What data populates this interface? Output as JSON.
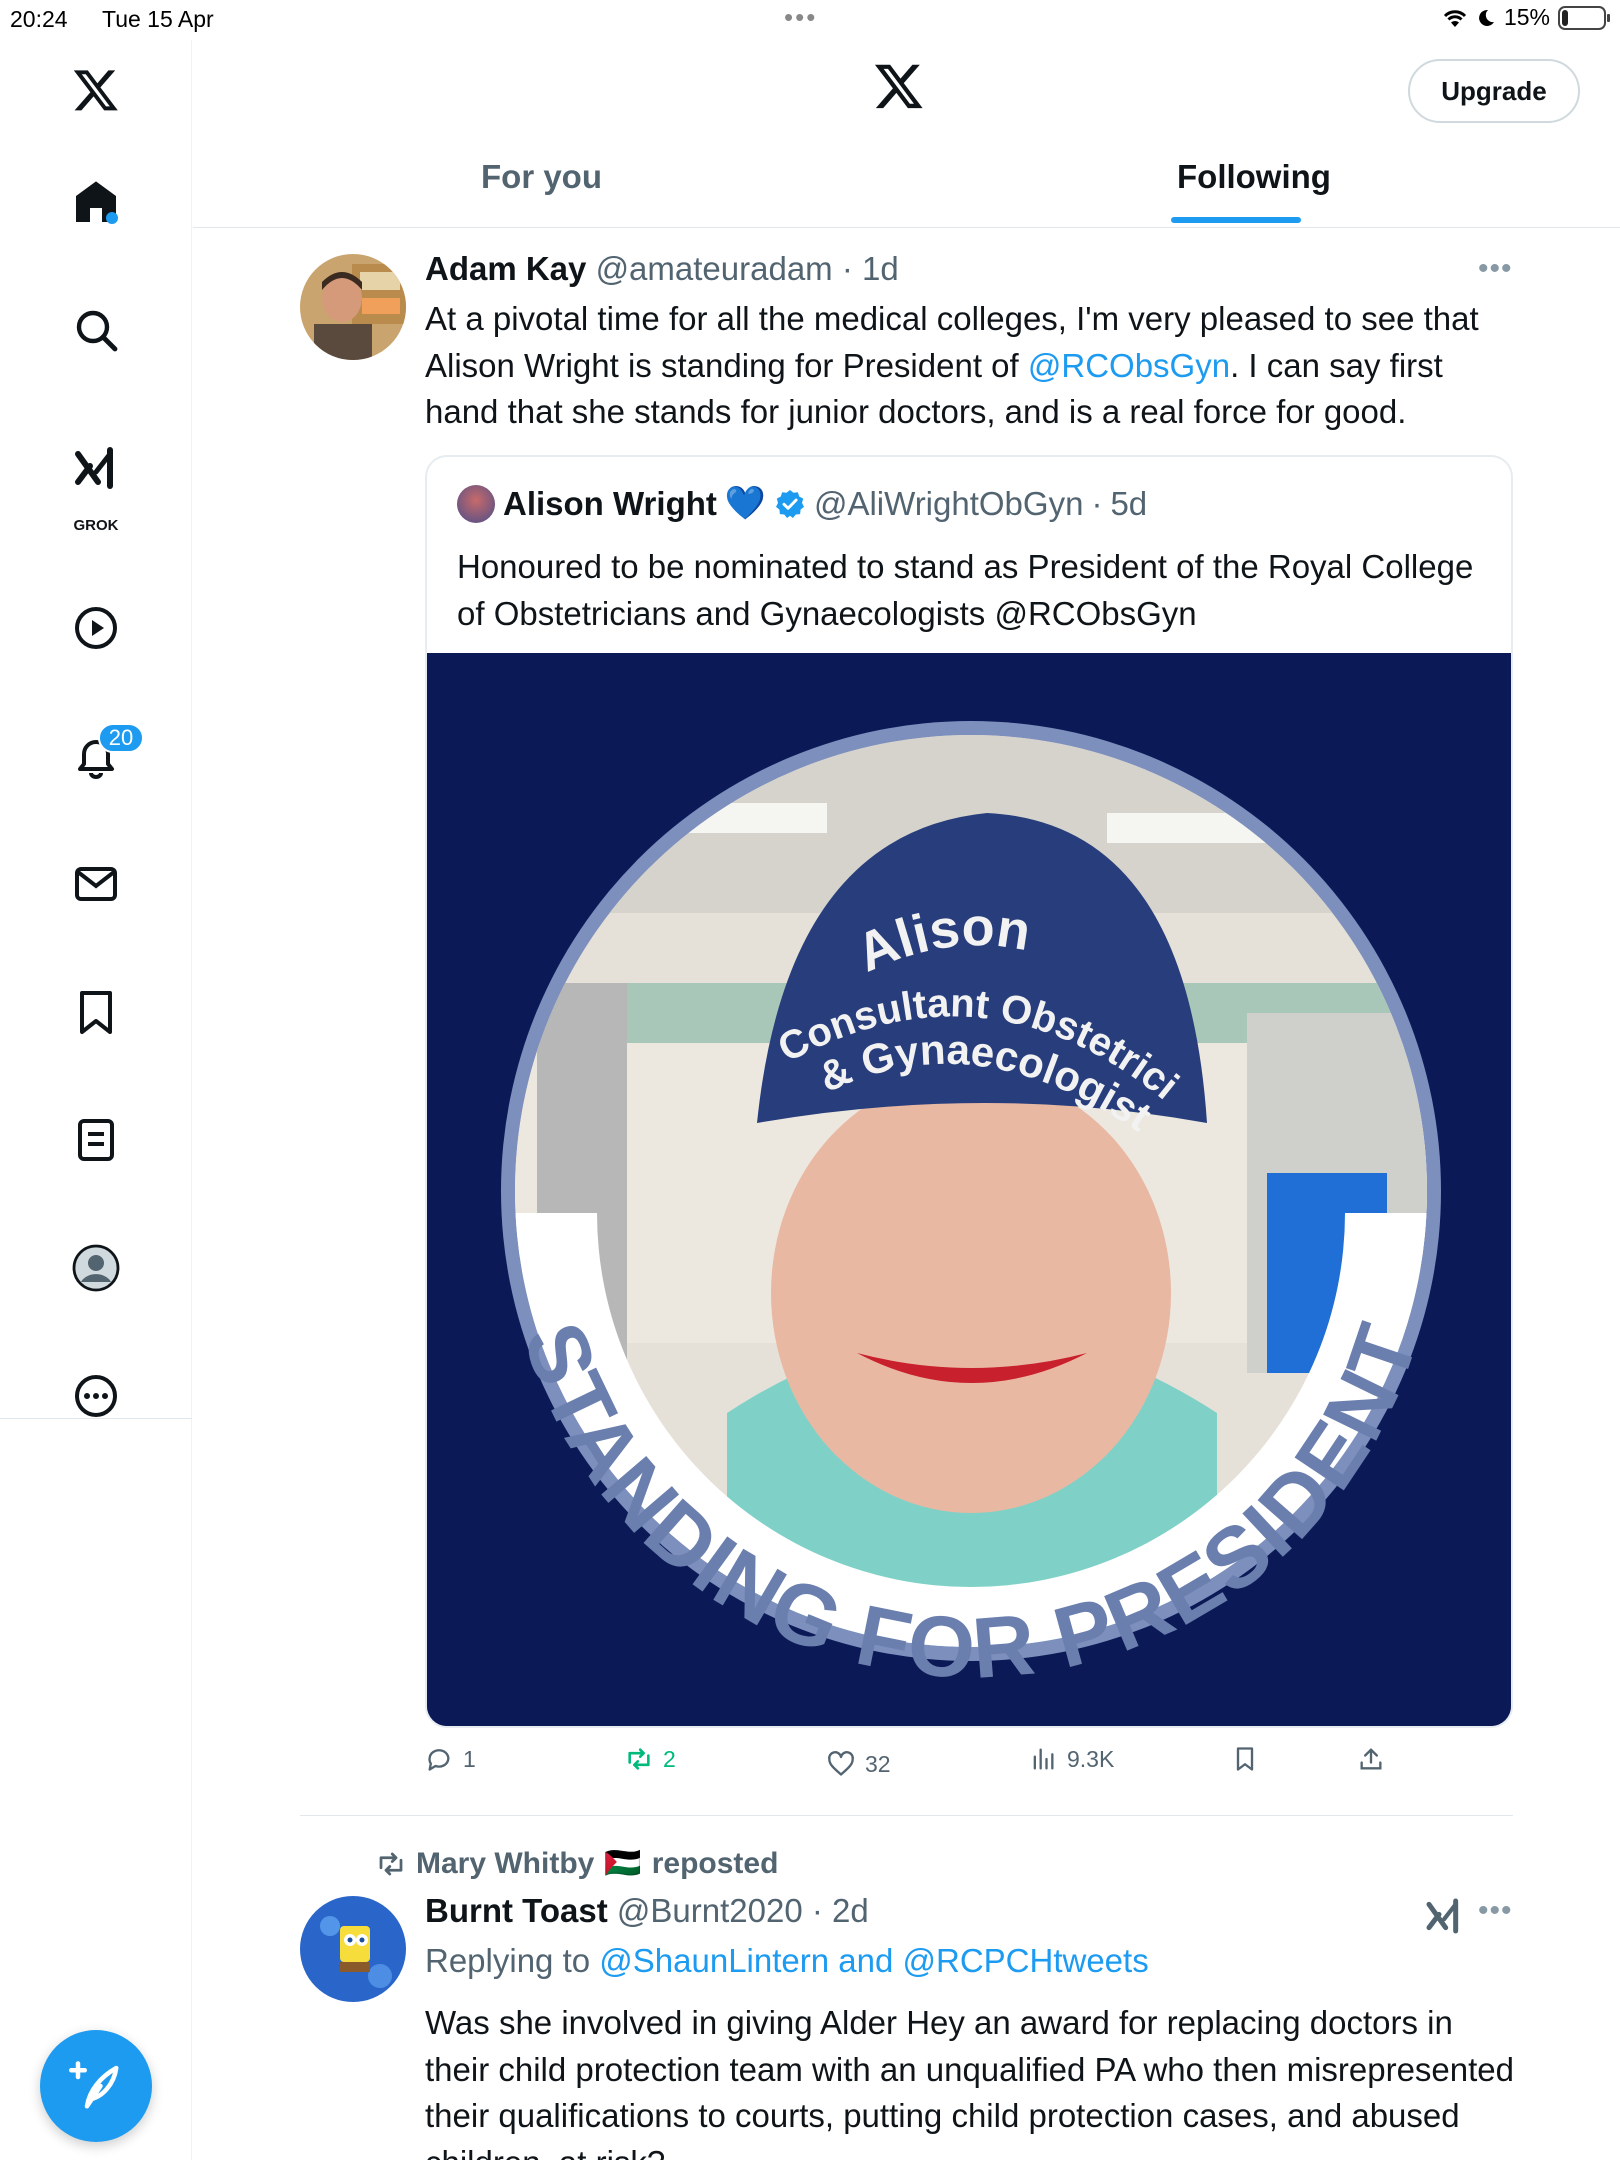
{
  "status_bar": {
    "time": "20:24",
    "date": "Tue 15 Apr",
    "battery": "15%",
    "battery_fraction": 0.15
  },
  "sidebar": {
    "grok_label": "GROK",
    "notifications_count": "20"
  },
  "header": {
    "upgrade_label": "Upgrade",
    "tabs": [
      {
        "label": "For you"
      },
      {
        "label": "Following"
      }
    ]
  },
  "tweet1": {
    "name": "Adam Kay",
    "handle": "@amateuradam",
    "time": "1d",
    "text_before": "At a pivotal time for all the medical colleges, I'm very pleased to see that Alison Wright is standing for President of ",
    "mention": "@RCObsGyn",
    "text_after": ". I can say first hand that she stands for junior doctors, and is a real force for good.",
    "quote": {
      "name": "Alison Wright",
      "emoji": "💙",
      "handle": "@AliWrightObGyn",
      "time": "5d",
      "text": "Honoured to be nominated to stand as President of the Royal College of Obstetricians and Gynaecologists @RCObsGyn",
      "image": {
        "cap_line1": "Alison",
        "cap_line2": "Consultant Obstetrician",
        "cap_line3": "& Gynaecologist",
        "banner": "STANDING FOR PRESIDENT"
      }
    },
    "actions": {
      "replies": "1",
      "reposts": "2",
      "likes": "32",
      "views": "9.3K"
    }
  },
  "tweet2": {
    "reposted_by": "Mary Whitby",
    "reposted_flag": "🇵🇸",
    "reposted_suffix": "reposted",
    "name": "Burnt Toast",
    "handle": "@Burnt2020",
    "time": "2d",
    "replying_prefix": "Replying to ",
    "replying_to": "@ShaunLintern and @RCPCHtweets",
    "text": "Was she involved in giving Alder Hey an award for replacing doctors in their child protection team with an unqualified PA who then misrepresented their qualifications to courts, putting child protection cases, and abused children, at risk?"
  },
  "colors": {
    "accent": "#1d9bf0",
    "muted": "#536471",
    "repost_green": "#00ba7c",
    "image_bg": "#0b1a57"
  }
}
